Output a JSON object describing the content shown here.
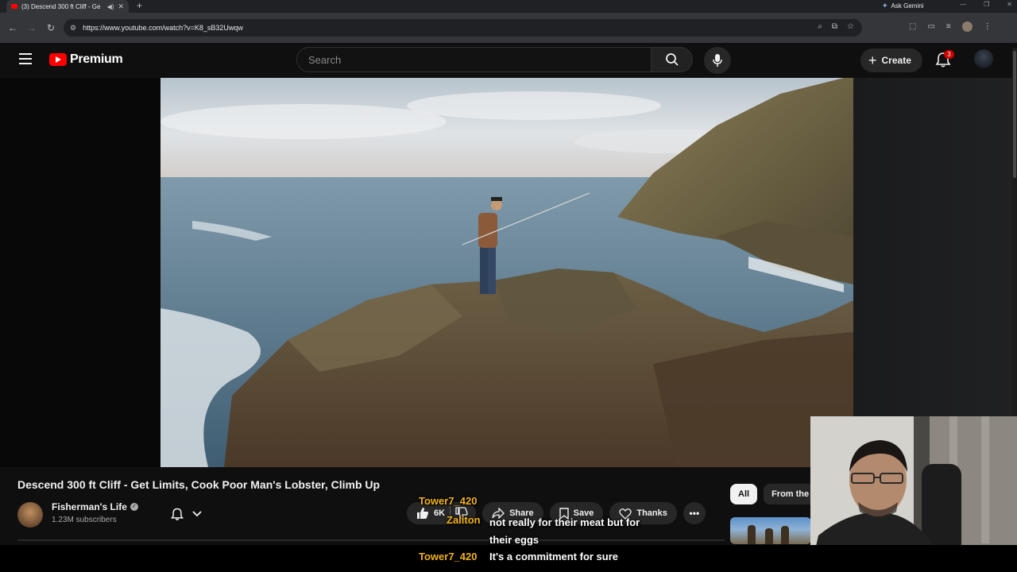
{
  "browser": {
    "tab_title": "(3) Descend 300 ft Cliff - Ge",
    "new_tab": "+",
    "ask_gemini": "Ask Gemini",
    "url": "https://www.youtube.com/watch?v=K8_sB32Uwqw"
  },
  "masthead": {
    "logo_text": "Premium",
    "search_placeholder": "Search",
    "create_label": "Create",
    "notification_count": "3"
  },
  "video": {
    "title": "Descend 300 ft Cliff - Get Limits, Cook Poor Man's Lobster, Climb Up",
    "channel_name": "Fisherman's Life",
    "subscribers": "1.23M subscribers",
    "like_count": "6K",
    "share_label": "Share",
    "save_label": "Save",
    "thanks_label": "Thanks",
    "more_label": "•••"
  },
  "chips": [
    {
      "label": "All",
      "active": true
    },
    {
      "label": "From the",
      "active": false
    }
  ],
  "chat": [
    {
      "user": "Tower7_420",
      "text": ""
    },
    {
      "user": "Zaliton",
      "text": "not really for their meat but for their eggs"
    },
    {
      "user": "Tower7_420",
      "text": "It's a commitment for sure"
    }
  ],
  "colors": {
    "youtube_red": "#ff0000",
    "chat_username": "#f2b21b",
    "background": "#0f0f0f"
  }
}
